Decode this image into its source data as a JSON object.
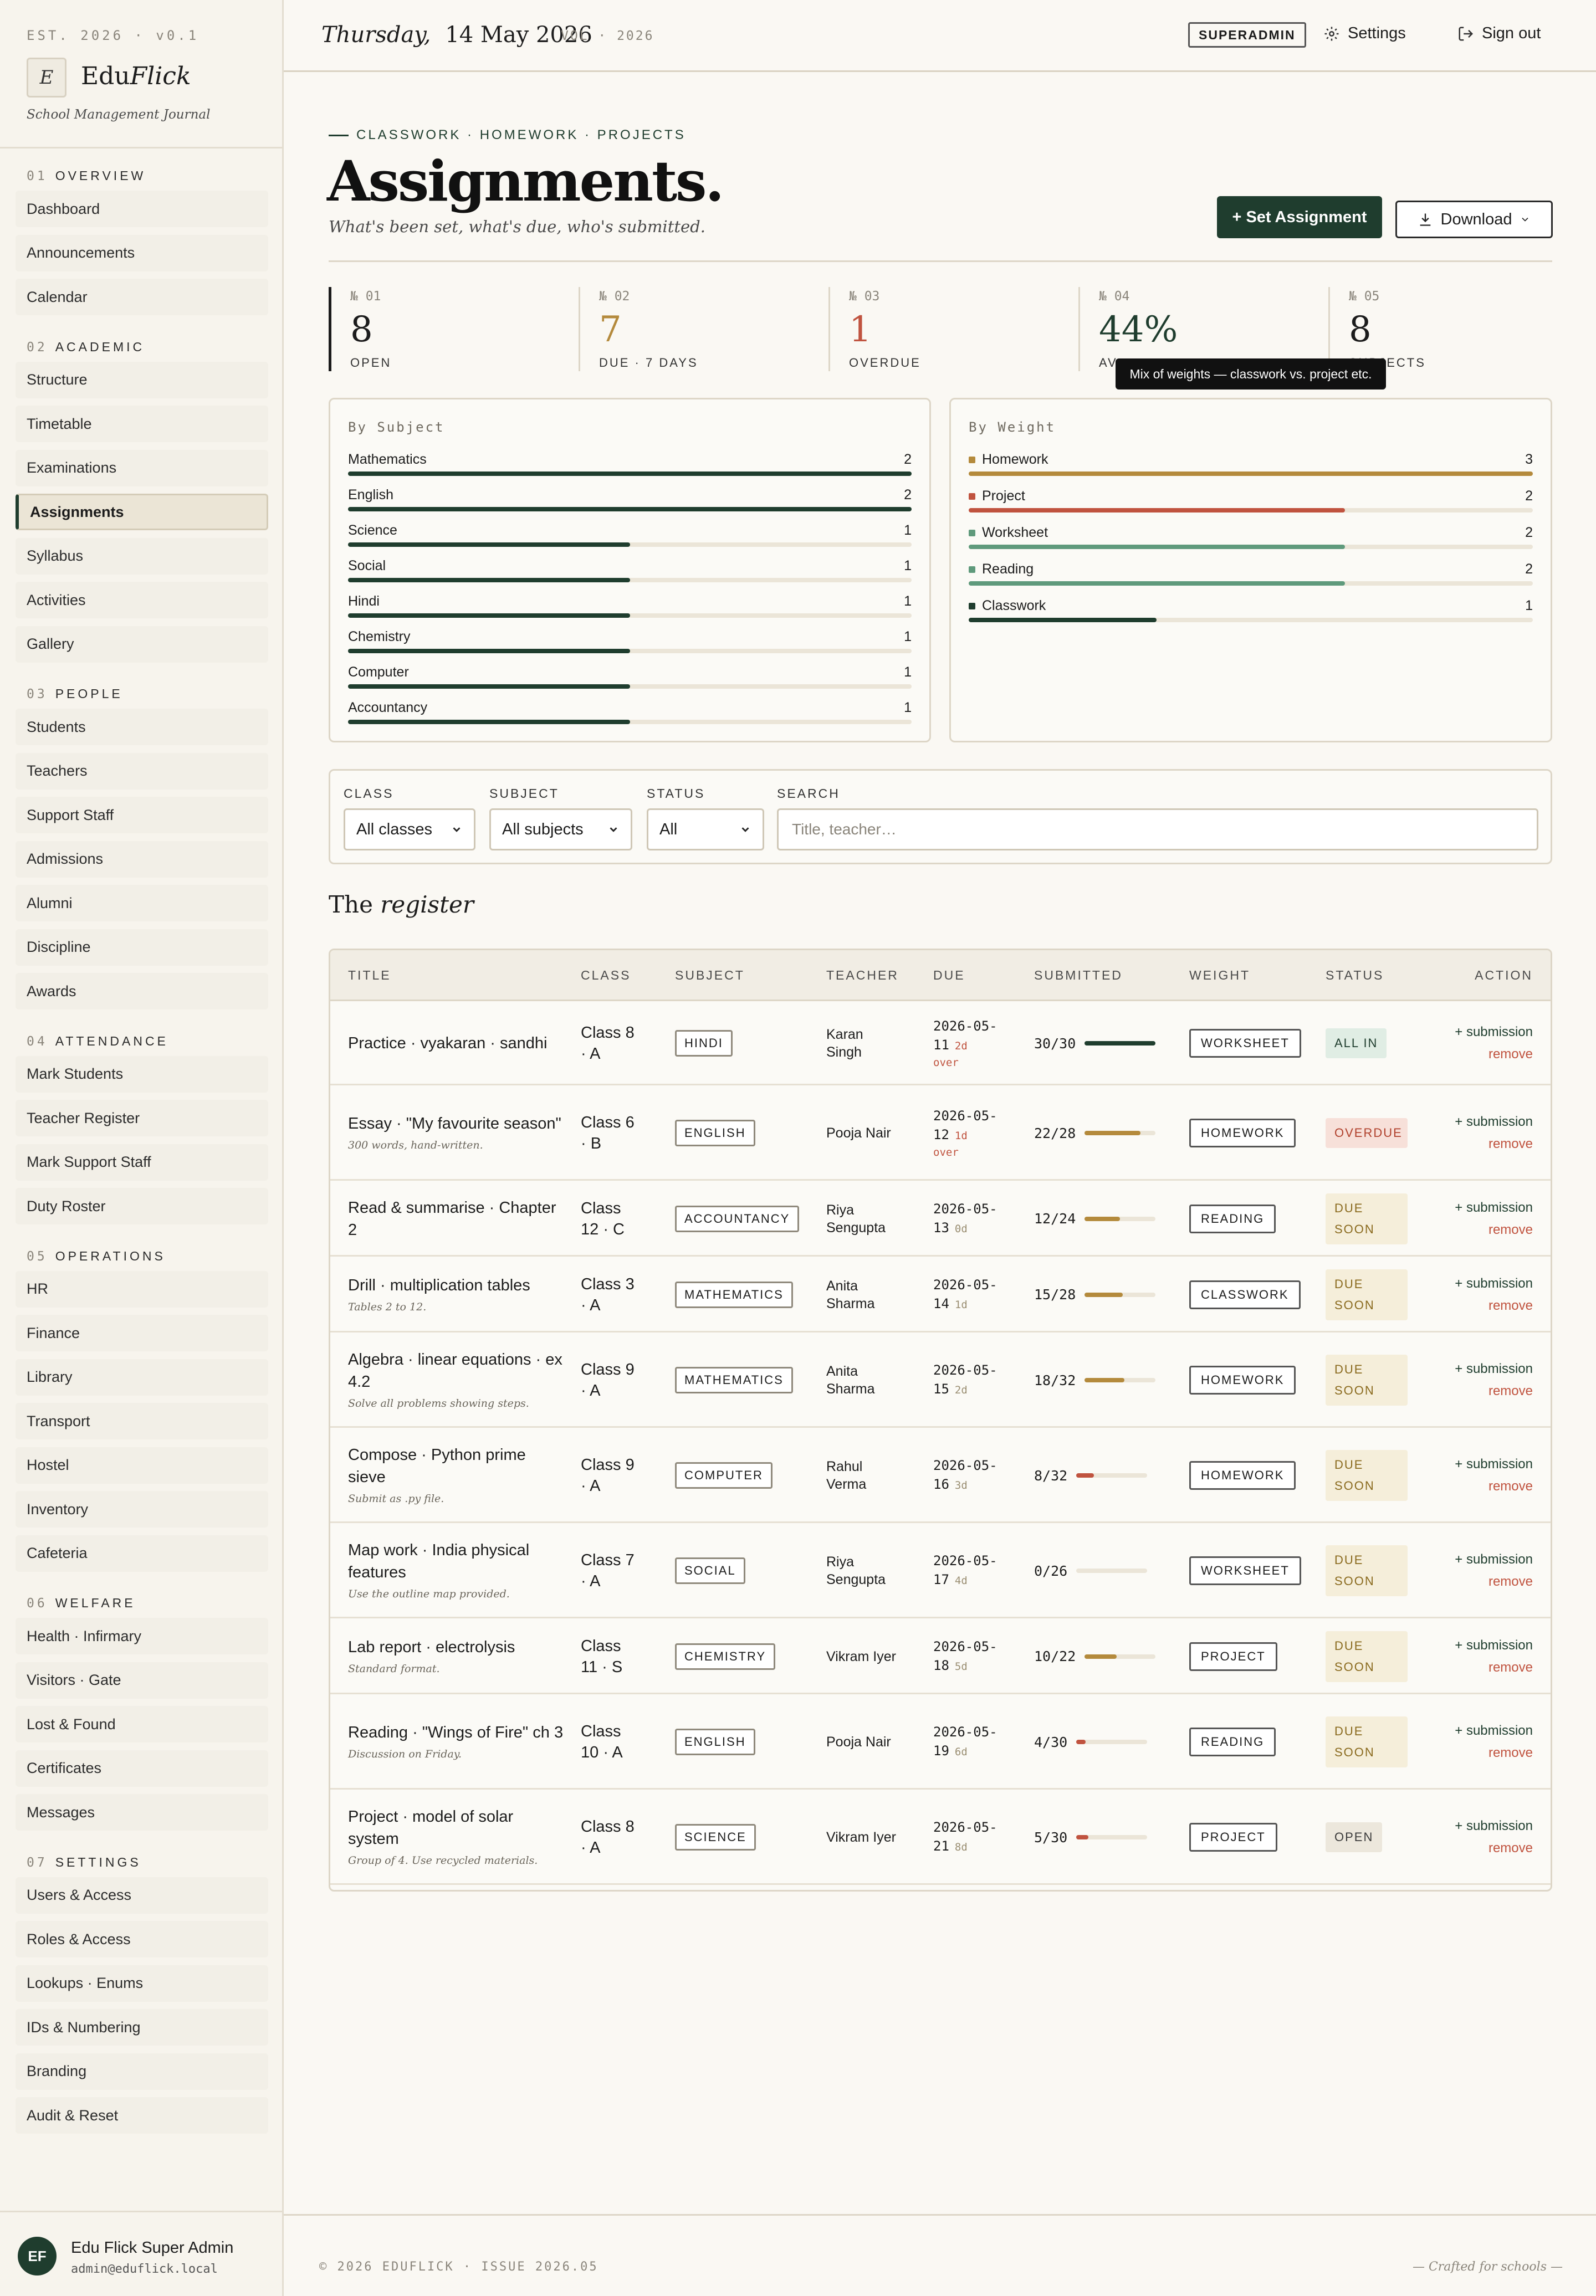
{
  "sidebar": {
    "est": "EST. 2026 · v0.1",
    "logo_letter": "E",
    "brand_a": "Edu",
    "brand_b": "Flick",
    "subtitle": "School Management Journal",
    "sections": [
      {
        "num": "01",
        "label": "OVERVIEW",
        "items": [
          "Dashboard",
          "Announcements",
          "Calendar"
        ]
      },
      {
        "num": "02",
        "label": "ACADEMIC",
        "items": [
          "Structure",
          "Timetable",
          "Examinations",
          "Assignments",
          "Syllabus",
          "Activities",
          "Gallery"
        ]
      },
      {
        "num": "03",
        "label": "PEOPLE",
        "items": [
          "Students",
          "Teachers",
          "Support Staff",
          "Admissions",
          "Alumni",
          "Discipline",
          "Awards"
        ]
      },
      {
        "num": "04",
        "label": "ATTENDANCE",
        "items": [
          "Mark Students",
          "Teacher Register",
          "Mark Support Staff",
          "Duty Roster"
        ]
      },
      {
        "num": "05",
        "label": "OPERATIONS",
        "items": [
          "HR",
          "Finance",
          "Library",
          "Transport",
          "Hostel",
          "Inventory",
          "Cafeteria"
        ]
      },
      {
        "num": "06",
        "label": "WELFARE",
        "items": [
          "Health · Infirmary",
          "Visitors · Gate",
          "Lost & Found",
          "Certificates",
          "Messages"
        ]
      },
      {
        "num": "07",
        "label": "SETTINGS",
        "items": [
          "Users & Access",
          "Roles & Access",
          "Lookups · Enums",
          "IDs & Numbering",
          "Branding",
          "Audit & Reset"
        ]
      }
    ],
    "active_item": "Assignments",
    "user": {
      "initials": "EF",
      "name": "Edu Flick Super Admin",
      "email": "admin@eduflick.local"
    }
  },
  "topbar": {
    "weekday": "Thursday,",
    "date": "14 May 2026",
    "vol": "VOL · 2026",
    "role": "SUPERADMIN",
    "settings": "Settings",
    "signout": "Sign out"
  },
  "header": {
    "eyebrow": "CLASSWORK · HOMEWORK · PROJECTS",
    "title": "Assignments.",
    "tagline": "What's been set, what's due, who's submitted.",
    "primary_btn": "+ Set Assignment",
    "download_btn": "Download"
  },
  "stats": [
    {
      "num": "№ 01",
      "value": "8",
      "label": "OPEN",
      "color": "#1c1c1c"
    },
    {
      "num": "№ 02",
      "value": "7",
      "label": "DUE · 7 DAYS",
      "color": "#b48a3c"
    },
    {
      "num": "№ 03",
      "value": "1",
      "label": "OVERDUE",
      "color": "#c0533f"
    },
    {
      "num": "№ 04",
      "value": "44%",
      "label": "AV",
      "color": "#1f3d2e"
    },
    {
      "num": "№ 05",
      "value": "8",
      "label": "SUBJECTS",
      "color": "#1c1c1c"
    }
  ],
  "tooltip": "Mix of weights — classwork vs. project etc.",
  "by_subject": {
    "title": "By Subject",
    "max": 2,
    "rows": [
      {
        "label": "Mathematics",
        "value": 2
      },
      {
        "label": "English",
        "value": 2
      },
      {
        "label": "Science",
        "value": 1
      },
      {
        "label": "Social",
        "value": 1
      },
      {
        "label": "Hindi",
        "value": 1
      },
      {
        "label": "Chemistry",
        "value": 1
      },
      {
        "label": "Computer",
        "value": 1
      },
      {
        "label": "Accountancy",
        "value": 1
      }
    ],
    "color": "#1f3d2e"
  },
  "by_weight": {
    "title": "By Weight",
    "max": 3,
    "rows": [
      {
        "label": "Homework",
        "value": 3,
        "color": "#b48a3c"
      },
      {
        "label": "Project",
        "value": 2,
        "color": "#c0533f"
      },
      {
        "label": "Worksheet",
        "value": 2,
        "color": "#5f9a7c"
      },
      {
        "label": "Reading",
        "value": 2,
        "color": "#5f9a7c"
      },
      {
        "label": "Classwork",
        "value": 1,
        "color": "#1f3d2e"
      }
    ]
  },
  "filters": {
    "class_label": "CLASS",
    "class_value": "All classes",
    "subject_label": "SUBJECT",
    "subject_value": "All subjects",
    "status_label": "STATUS",
    "status_value": "All",
    "search_label": "SEARCH",
    "search_placeholder": "Title, teacher…"
  },
  "register": {
    "title_a": "The",
    "title_b": "register",
    "columns": [
      "TITLE",
      "CLASS",
      "SUBJECT",
      "TEACHER",
      "DUE",
      "SUBMITTED",
      "WEIGHT",
      "STATUS",
      "ACTION"
    ],
    "add_label": "+ submission",
    "remove_label": "remove",
    "rows": [
      {
        "title": "Practice · vyakaran · sandhi",
        "note": "",
        "class_a": "Class 8",
        "class_b": "· A",
        "subject": "HINDI",
        "teacher_a": "Karan",
        "teacher_b": "Singh",
        "due_a": "2026-05-",
        "due_b": "11",
        "rel": "2d",
        "over": "over",
        "submitted": 30,
        "total": 30,
        "submitted_text": "30/30",
        "weight": "WORKSHEET",
        "status": "ALL IN",
        "status_kind": "allin"
      },
      {
        "title": "Essay · \"My favourite season\"",
        "note": "300 words, hand-written.",
        "class_a": "Class 6",
        "class_b": "· B",
        "subject": "ENGLISH",
        "teacher_a": "Pooja Nair",
        "teacher_b": "",
        "due_a": "2026-05-",
        "due_b": "12",
        "rel": "1d",
        "over": "over",
        "submitted": 22,
        "total": 28,
        "submitted_text": "22/28",
        "weight": "HOMEWORK",
        "status": "OVERDUE",
        "status_kind": "overdue"
      },
      {
        "title": "Read & summarise · Chapter 2",
        "note": "",
        "class_a": "Class",
        "class_b": "12 · C",
        "subject": "ACCOUNTANCY",
        "teacher_a": "Riya",
        "teacher_b": "Sengupta",
        "due_a": "2026-05-",
        "due_b": "13",
        "rel": "0d",
        "over": "",
        "submitted": 12,
        "total": 24,
        "submitted_text": "12/24",
        "weight": "READING",
        "status": "DUE SOON",
        "status_kind": "due"
      },
      {
        "title": "Drill · multiplication tables",
        "note": "Tables 2 to 12.",
        "class_a": "Class 3",
        "class_b": "· A",
        "subject": "MATHEMATICS",
        "teacher_a": "Anita",
        "teacher_b": "Sharma",
        "due_a": "2026-05-",
        "due_b": "14",
        "rel": "1d",
        "over": "",
        "submitted": 15,
        "total": 28,
        "submitted_text": "15/28",
        "weight": "CLASSWORK",
        "status": "DUE SOON",
        "status_kind": "due"
      },
      {
        "title": "Algebra · linear equations · ex 4.2",
        "note": "Solve all problems showing steps.",
        "class_a": "Class 9",
        "class_b": "· A",
        "subject": "MATHEMATICS",
        "teacher_a": "Anita",
        "teacher_b": "Sharma",
        "due_a": "2026-05-",
        "due_b": "15",
        "rel": "2d",
        "over": "",
        "submitted": 18,
        "total": 32,
        "submitted_text": "18/32",
        "weight": "HOMEWORK",
        "status": "DUE SOON",
        "status_kind": "due"
      },
      {
        "title": "Compose · Python prime sieve",
        "note": "Submit as .py file.",
        "class_a": "Class 9",
        "class_b": "· A",
        "subject": "COMPUTER",
        "teacher_a": "Rahul",
        "teacher_b": "Verma",
        "due_a": "2026-05-",
        "due_b": "16",
        "rel": "3d",
        "over": "",
        "submitted": 8,
        "total": 32,
        "submitted_text": "8/32",
        "weight": "HOMEWORK",
        "status": "DUE SOON",
        "status_kind": "due"
      },
      {
        "title": "Map work · India physical features",
        "note": "Use the outline map provided.",
        "class_a": "Class 7",
        "class_b": "· A",
        "subject": "SOCIAL",
        "teacher_a": "Riya",
        "teacher_b": "Sengupta",
        "due_a": "2026-05-",
        "due_b": "17",
        "rel": "4d",
        "over": "",
        "submitted": 0,
        "total": 26,
        "submitted_text": "0/26",
        "weight": "WORKSHEET",
        "status": "DUE SOON",
        "status_kind": "due"
      },
      {
        "title": "Lab report · electrolysis",
        "note": "Standard format.",
        "class_a": "Class",
        "class_b": "11 · S",
        "subject": "CHEMISTRY",
        "teacher_a": "Vikram Iyer",
        "teacher_b": "",
        "due_a": "2026-05-",
        "due_b": "18",
        "rel": "5d",
        "over": "",
        "submitted": 10,
        "total": 22,
        "submitted_text": "10/22",
        "weight": "PROJECT",
        "status": "DUE SOON",
        "status_kind": "due"
      },
      {
        "title": "Reading · \"Wings of Fire\" ch 3",
        "note": "Discussion on Friday.",
        "class_a": "Class",
        "class_b": "10 · A",
        "subject": "ENGLISH",
        "teacher_a": "Pooja Nair",
        "teacher_b": "",
        "due_a": "2026-05-",
        "due_b": "19",
        "rel": "6d",
        "over": "",
        "submitted": 4,
        "total": 30,
        "submitted_text": "4/30",
        "weight": "READING",
        "status": "DUE SOON",
        "status_kind": "due"
      },
      {
        "title": "Project · model of solar system",
        "note": "Group of 4. Use recycled materials.",
        "class_a": "Class 8",
        "class_b": "· A",
        "subject": "SCIENCE",
        "teacher_a": "Vikram Iyer",
        "teacher_b": "",
        "due_a": "2026-05-",
        "due_b": "21",
        "rel": "8d",
        "over": "",
        "submitted": 5,
        "total": 30,
        "submitted_text": "5/30",
        "weight": "PROJECT",
        "status": "OPEN",
        "status_kind": "open"
      }
    ]
  },
  "footer": {
    "left": "© 2026 EDUFLICK · ISSUE 2026.05",
    "right": "— Crafted for schools —"
  },
  "colors": {
    "accent": "#1f3d2e",
    "warn": "#b48a3c",
    "danger": "#c0533f"
  }
}
